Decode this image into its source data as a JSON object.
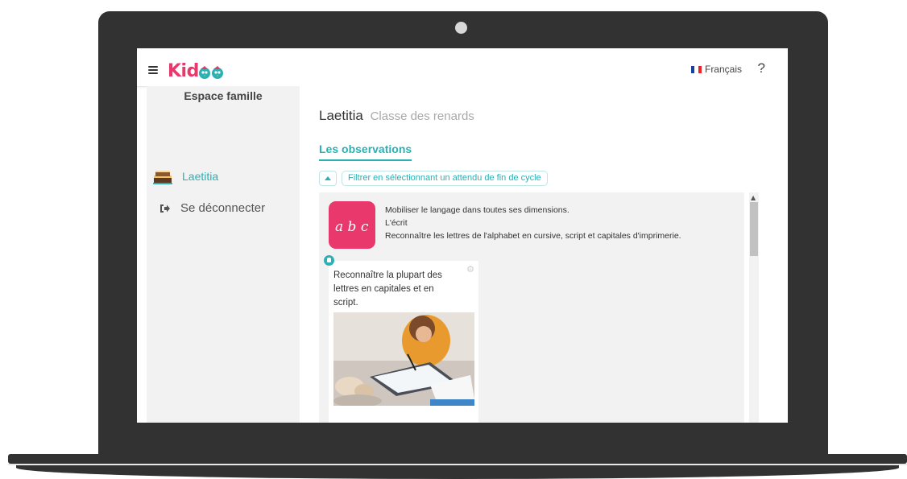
{
  "app": {
    "logo_text": "Kid",
    "brand_color": "#e8386c",
    "accent_color": "#2bb0b4"
  },
  "header": {
    "language": "Français",
    "help": "?"
  },
  "sidebar": {
    "title": "Espace famille",
    "items": [
      {
        "label": "Laetitia",
        "icon": "cake-icon",
        "active": true
      },
      {
        "label": "Se déconnecter",
        "icon": "logout-icon",
        "active": false
      }
    ]
  },
  "main": {
    "child_name": "Laetitia",
    "class_name": "Classe des renards",
    "tab_label": "Les observations",
    "filter_label": "Filtrer en sélectionnant un attendu de fin de cycle",
    "domain": {
      "icon_text": "a b c",
      "line1": "Mobiliser le langage dans toutes ses dimensions.",
      "line2": "L'écrit",
      "line3": "Reconnaître les lettres de l'alphabet en cursive, script et capitales d'imprimerie."
    },
    "card": {
      "text": "Reconnaître la plupart des lettres en capitales et en script."
    }
  }
}
